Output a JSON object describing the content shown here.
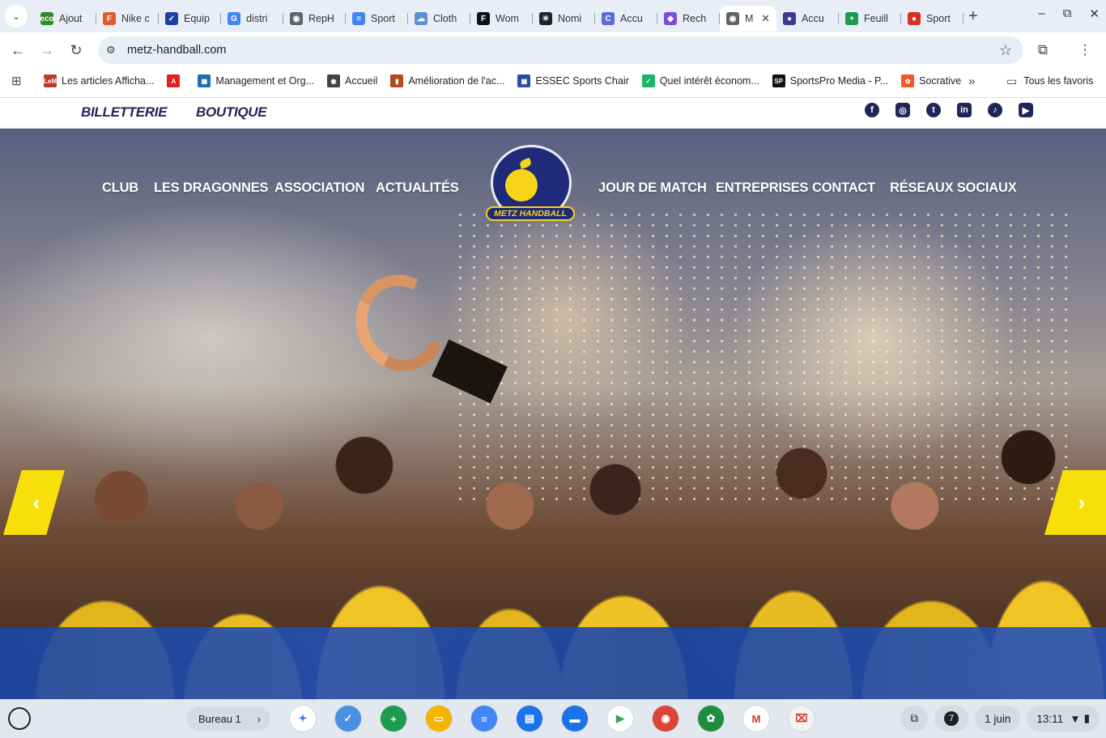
{
  "browser": {
    "tabs": [
      {
        "title": "Ajout",
        "color": "#2e8b2e",
        "glyph": "eco"
      },
      {
        "title": "Nike c",
        "color": "#e8572a",
        "glyph": "F"
      },
      {
        "title": "Equip",
        "color": "#1f3fa6",
        "glyph": "✓"
      },
      {
        "title": "distri",
        "color": "#4285f4",
        "glyph": "G"
      },
      {
        "title": "RepH",
        "color": "#5f6368",
        "glyph": "◉"
      },
      {
        "title": "Sport",
        "color": "#4285f4",
        "glyph": "≡"
      },
      {
        "title": "Cloth",
        "color": "#5b8fd6",
        "glyph": "☁"
      },
      {
        "title": "Wom",
        "color": "#111111",
        "glyph": "F"
      },
      {
        "title": "Nomi",
        "color": "#222222",
        "glyph": "✳"
      },
      {
        "title": "Accu",
        "color": "#5b6bd8",
        "glyph": "C"
      },
      {
        "title": "Rech",
        "color": "#7b4fd8",
        "glyph": "◆"
      },
      {
        "title": "M",
        "color": "#5f6368",
        "glyph": "◉",
        "active": true
      },
      {
        "title": "Accu",
        "color": "#3a3a90",
        "glyph": "●"
      },
      {
        "title": "Feuill",
        "color": "#1e9a4f",
        "glyph": "+"
      },
      {
        "title": "Sport",
        "color": "#d93025",
        "glyph": "●"
      }
    ],
    "active_tab_close": "✕",
    "new_tab": "+",
    "window_controls": {
      "minimize": "–",
      "maximize": "⧉",
      "close": "✕"
    },
    "url": "metz-handball.com",
    "bookmarks": [
      {
        "label": "Les articles Afficha...",
        "color": "#c0392b",
        "glyph": "LeM"
      },
      {
        "label": "",
        "color": "#e01f1f",
        "glyph": "A"
      },
      {
        "label": "Management et Org...",
        "color": "#1f6fb5",
        "glyph": "▦"
      },
      {
        "label": "Accueil",
        "color": "#444444",
        "glyph": "◉"
      },
      {
        "label": "Amélioration de l'ac...",
        "color": "#b5481d",
        "glyph": "▮"
      },
      {
        "label": "ESSEC Sports Chair",
        "color": "#2a4ba8",
        "glyph": "▦"
      },
      {
        "label": "Quel intérêt économ...",
        "color": "#1eb56a",
        "glyph": "✓"
      },
      {
        "label": "SportsPro Media - P...",
        "color": "#111111",
        "glyph": "SP"
      },
      {
        "label": "Socrative",
        "color": "#f05a28",
        "glyph": "✿"
      }
    ],
    "bookmarks_overflow": "»",
    "all_bookmarks": "Tous les favoris"
  },
  "site": {
    "top_links": [
      "BILLETTERIE",
      "BOUTIQUE"
    ],
    "socials": [
      {
        "name": "facebook-icon",
        "glyph": "f"
      },
      {
        "name": "instagram-icon",
        "glyph": "◎"
      },
      {
        "name": "twitter-icon",
        "glyph": "t"
      },
      {
        "name": "linkedin-icon",
        "glyph": "in"
      },
      {
        "name": "tiktok-icon",
        "glyph": "♪"
      },
      {
        "name": "youtube-icon",
        "glyph": "▶"
      }
    ],
    "nav_left": [
      "CLUB",
      "LES DRAGONNES",
      "ASSOCIATION",
      "ACTUALITÉS"
    ],
    "nav_right": [
      "JOUR DE MATCH",
      "ENTREPRISES",
      "CONTACT",
      "RÉSEAUX SOCIAUX"
    ],
    "logo_text": "METZ HANDBALL",
    "slider_prev": "‹",
    "slider_next": "›"
  },
  "shelf": {
    "desk_label": "Bureau 1",
    "desk_chevron": "›",
    "apps": [
      {
        "name": "gemini-icon",
        "color": "#ffffff",
        "glyph": "✦",
        "fg": "#4a7bf0"
      },
      {
        "name": "tasks-icon",
        "color": "#4a90e2",
        "glyph": "✓",
        "fg": "#ffffff"
      },
      {
        "name": "sheets-icon",
        "color": "#1e9a4f",
        "glyph": "+",
        "fg": "#ffffff"
      },
      {
        "name": "slides-icon",
        "color": "#f4b400",
        "glyph": "▭",
        "fg": "#ffffff"
      },
      {
        "name": "docs-icon",
        "color": "#4285f4",
        "glyph": "≡",
        "fg": "#ffffff"
      },
      {
        "name": "messages-icon",
        "color": "#1a73e8",
        "glyph": "▤",
        "fg": "#ffffff"
      },
      {
        "name": "files-icon",
        "color": "#1a73e8",
        "glyph": "▬",
        "fg": "#ffffff"
      },
      {
        "name": "play-store-icon",
        "color": "#ffffff",
        "glyph": "▶",
        "fg": "#34a853"
      },
      {
        "name": "chrome-icon",
        "color": "#db4437",
        "glyph": "◉",
        "fg": "#ffffff"
      },
      {
        "name": "google-one-icon",
        "color": "#1e8e3e",
        "glyph": "✿",
        "fg": "#ffffff"
      },
      {
        "name": "gmail-icon",
        "color": "#ffffff",
        "glyph": "M",
        "fg": "#d93025"
      },
      {
        "name": "other-app-icon",
        "color": "#f1f3f4",
        "glyph": "⌧",
        "fg": "#d93025"
      }
    ],
    "notif_count": "7",
    "date": "1 juin",
    "time": "13:11"
  }
}
